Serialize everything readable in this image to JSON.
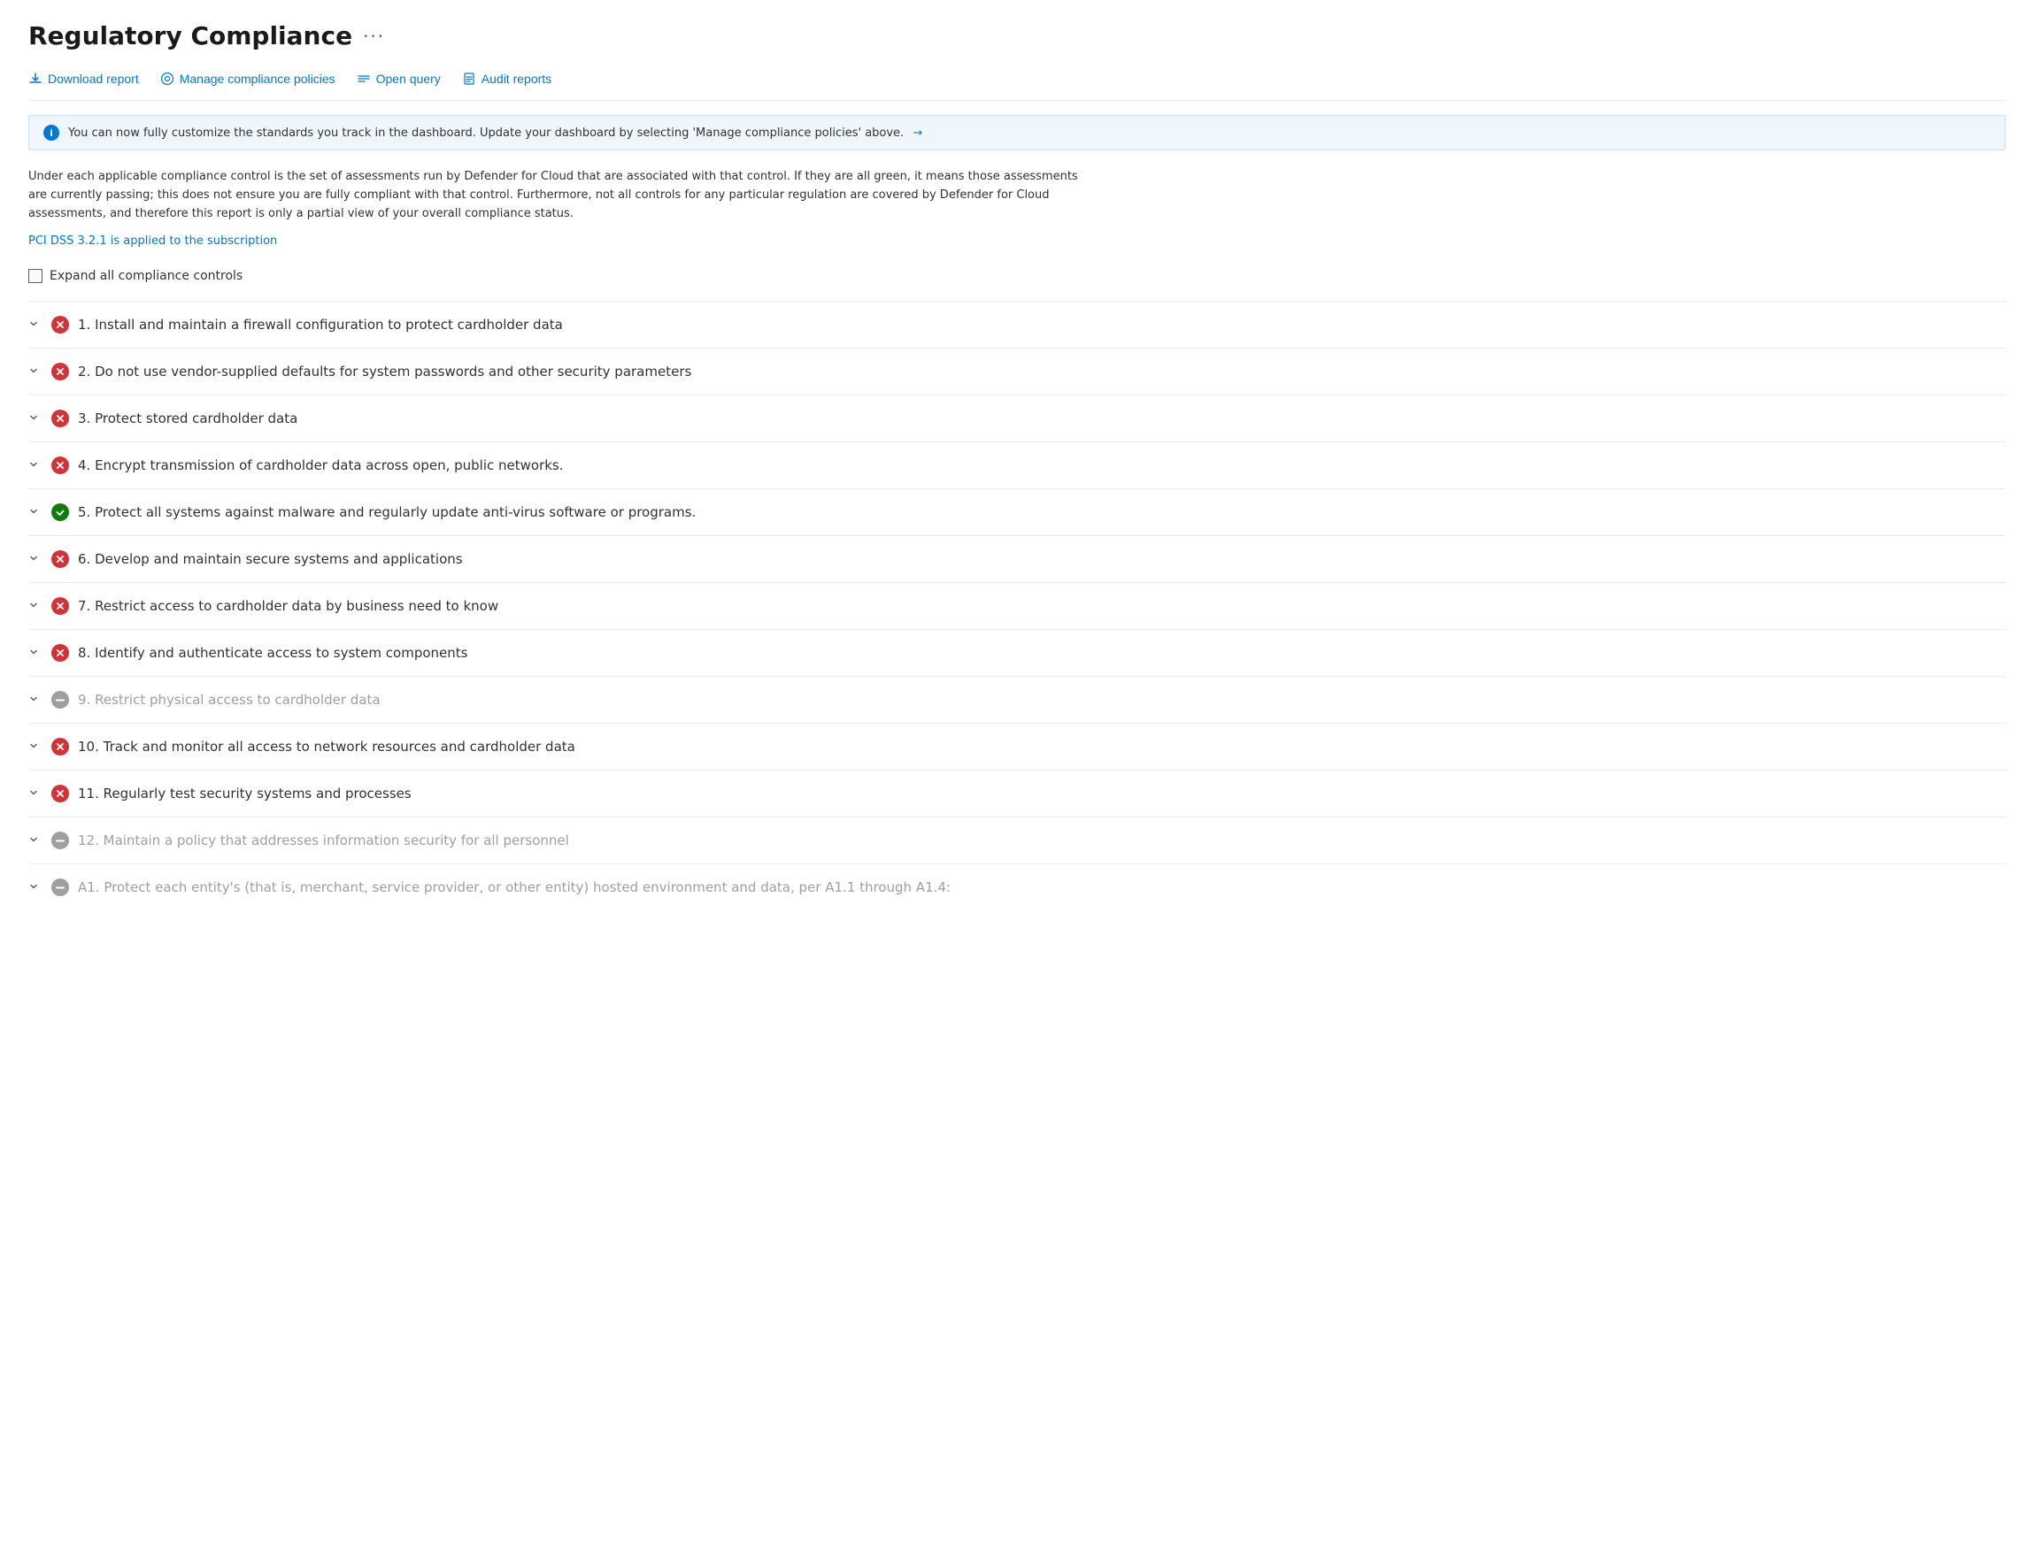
{
  "page": {
    "title": "Regulatory Compliance",
    "ellipsis": "···"
  },
  "toolbar": {
    "buttons": [
      {
        "id": "download-report",
        "label": "Download report",
        "icon": "↓"
      },
      {
        "id": "manage-compliance",
        "label": "Manage compliance policies",
        "icon": "⚙"
      },
      {
        "id": "open-query",
        "label": "Open query",
        "icon": "⋈"
      },
      {
        "id": "audit-reports",
        "label": "Audit reports",
        "icon": "📋"
      }
    ]
  },
  "info_banner": {
    "text": "You can now fully customize the standards you track in the dashboard. Update your dashboard by selecting 'Manage compliance policies' above.",
    "arrow": "→"
  },
  "description": "Under each applicable compliance control is the set of assessments run by Defender for Cloud that are associated with that control. If they are all green, it means those assessments are currently passing; this does not ensure you are fully compliant with that control. Furthermore, not all controls for any particular regulation are covered by Defender for Cloud assessments, and therefore this report is only a partial view of your overall compliance status.",
  "subscription_link": "PCI DSS 3.2.1 is applied to the subscription",
  "expand_label": "Expand all compliance controls",
  "controls": [
    {
      "id": 1,
      "label": "1. Install and maintain a firewall configuration to protect cardholder data",
      "status": "error",
      "muted": false
    },
    {
      "id": 2,
      "label": "2. Do not use vendor-supplied defaults for system passwords and other security parameters",
      "status": "error",
      "muted": false
    },
    {
      "id": 3,
      "label": "3. Protect stored cardholder data",
      "status": "error",
      "muted": false
    },
    {
      "id": 4,
      "label": "4. Encrypt transmission of cardholder data across open, public networks.",
      "status": "error",
      "muted": false
    },
    {
      "id": 5,
      "label": "5. Protect all systems against malware and regularly update anti-virus software or programs.",
      "status": "success",
      "muted": false
    },
    {
      "id": 6,
      "label": "6. Develop and maintain secure systems and applications",
      "status": "error",
      "muted": false
    },
    {
      "id": 7,
      "label": "7. Restrict access to cardholder data by business need to know",
      "status": "error",
      "muted": false
    },
    {
      "id": 8,
      "label": "8. Identify and authenticate access to system components",
      "status": "error",
      "muted": false
    },
    {
      "id": 9,
      "label": "9. Restrict physical access to cardholder data",
      "status": "grey",
      "muted": true
    },
    {
      "id": 10,
      "label": "10. Track and monitor all access to network resources and cardholder data",
      "status": "error",
      "muted": false
    },
    {
      "id": 11,
      "label": "11. Regularly test security systems and processes",
      "status": "error",
      "muted": false
    },
    {
      "id": 12,
      "label": "12. Maintain a policy that addresses information security for all personnel",
      "status": "grey",
      "muted": true
    },
    {
      "id": 13,
      "label": "A1. Protect each entity's (that is, merchant, service provider, or other entity) hosted environment and data, per A1.1 through A1.4:",
      "status": "grey",
      "muted": true
    }
  ]
}
